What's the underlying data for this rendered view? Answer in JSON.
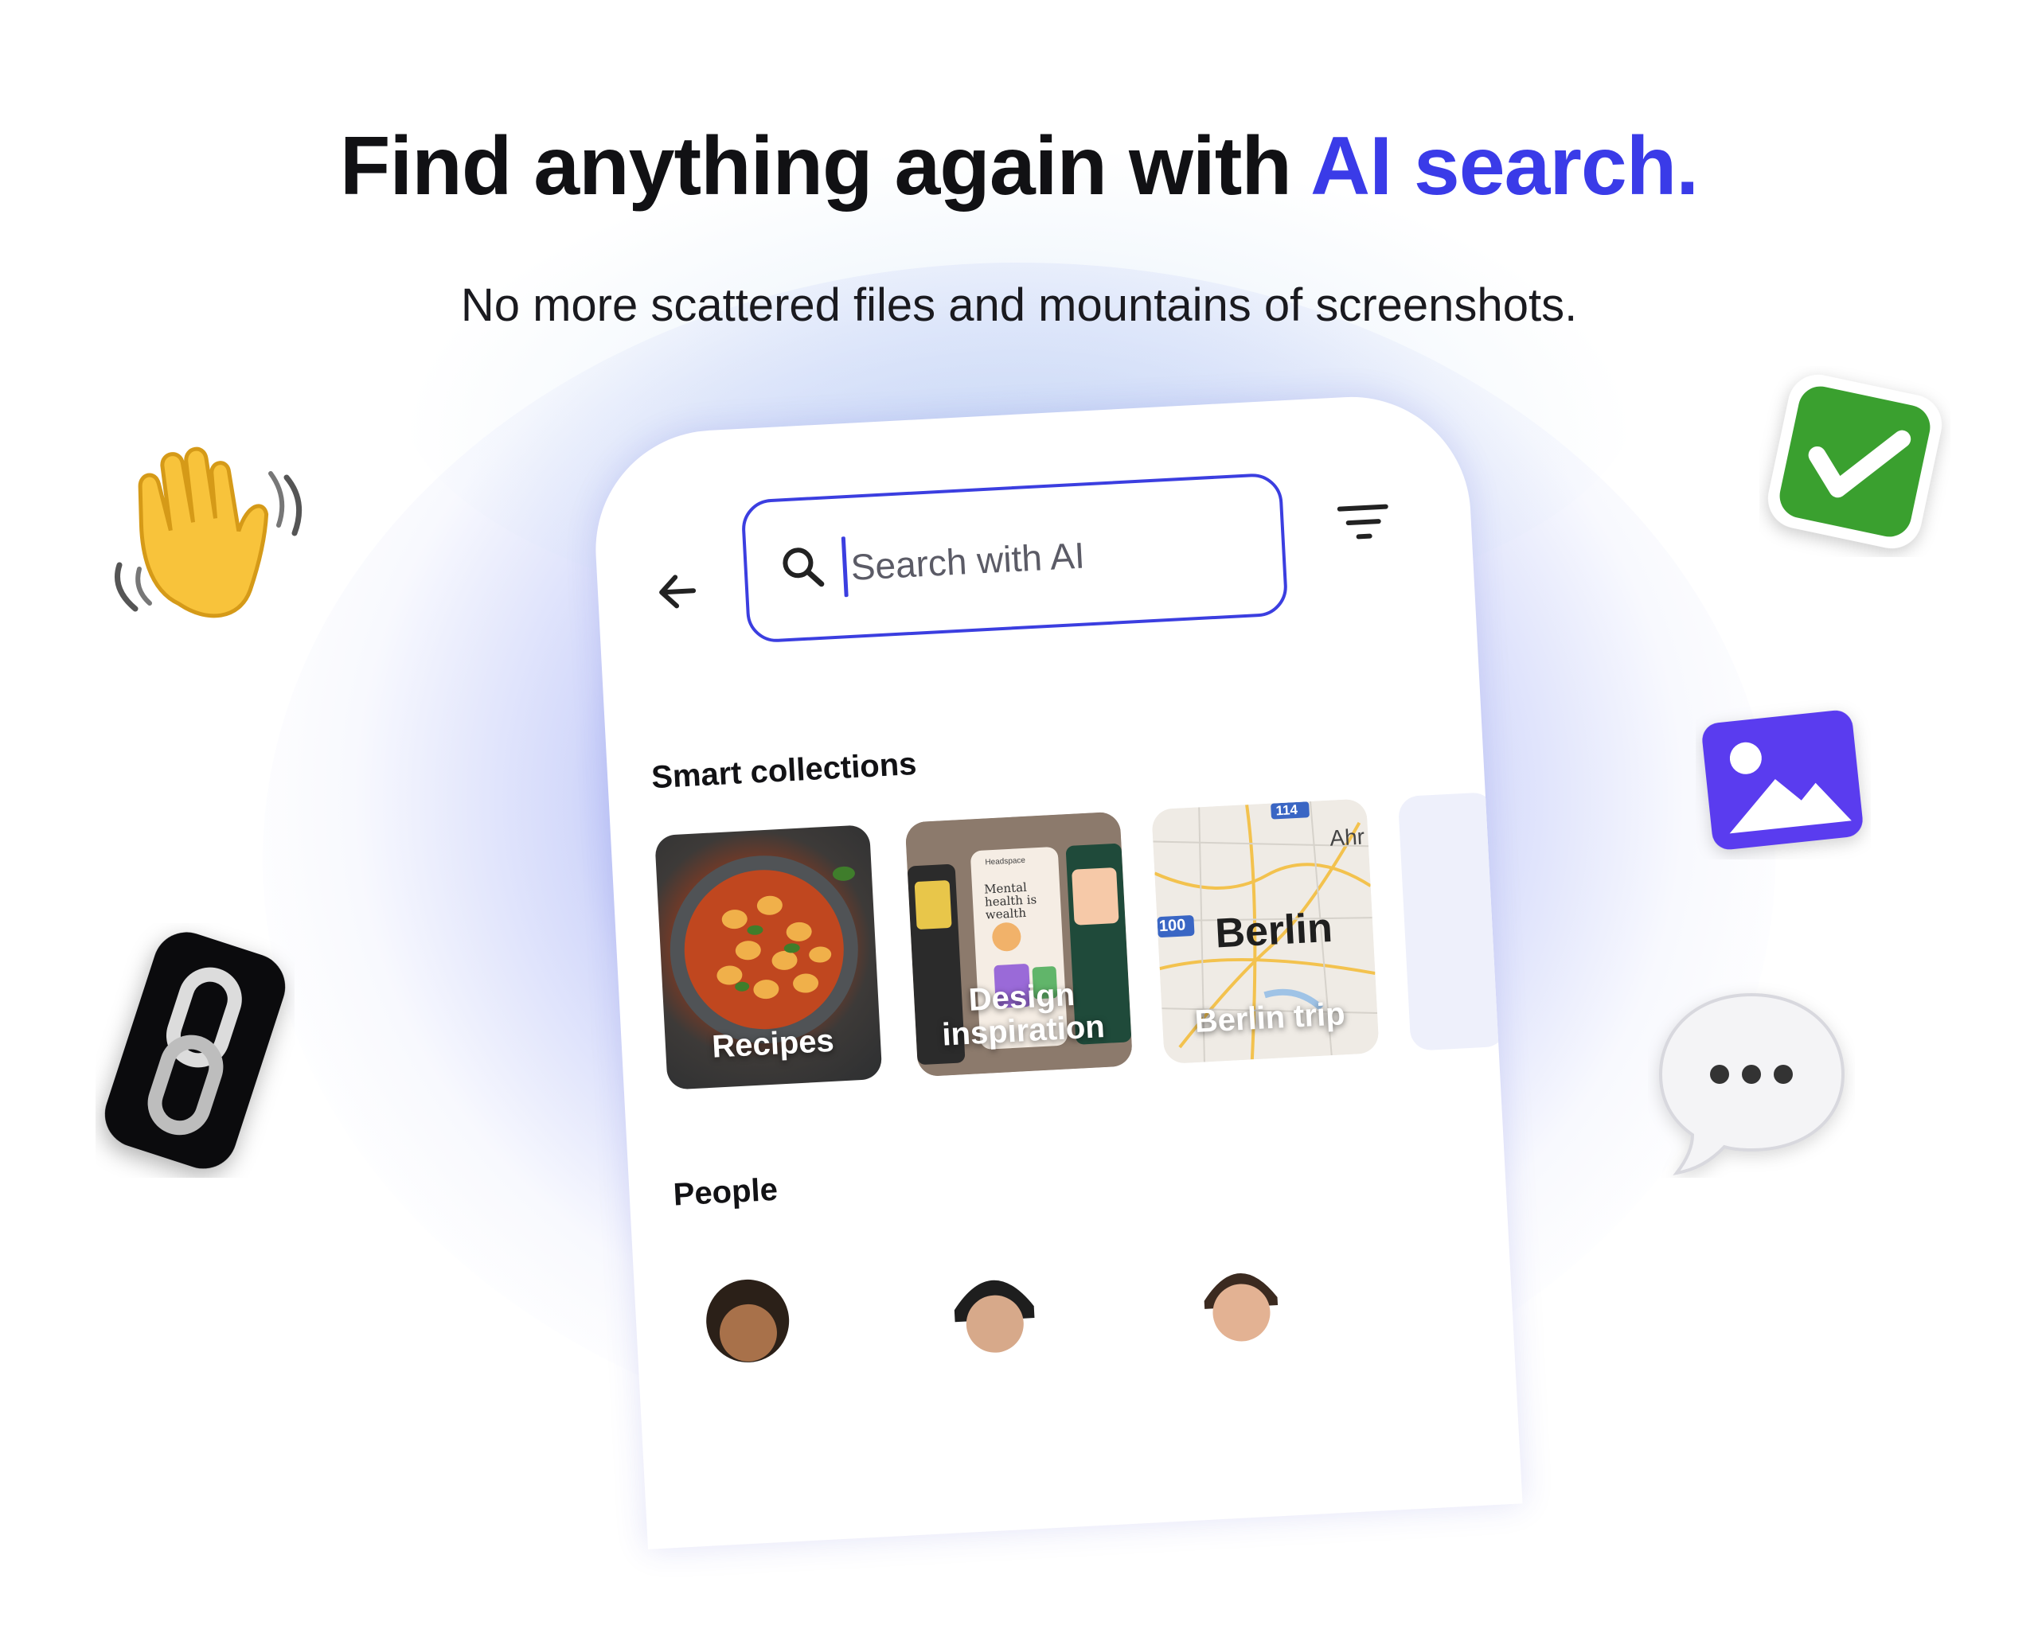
{
  "headline": {
    "main": "Find anything again with ",
    "accent": "AI search."
  },
  "subheadline": "No more scattered files and mountains of screenshots.",
  "app": {
    "search": {
      "placeholder": "Search with AI"
    },
    "sections": {
      "smart_collections": {
        "title": "Smart collections",
        "items": [
          {
            "label": "Recipes"
          },
          {
            "label": "Design inspiration"
          },
          {
            "label": "Berlin trip"
          }
        ]
      },
      "people": {
        "title": "People"
      }
    },
    "design_card_text": {
      "headline_mock": "Mental health is wealth",
      "brand_mock": "Headspace"
    },
    "berlin_map_text": {
      "city": "Berlin",
      "road1": "100",
      "road2": "114",
      "place": "Ahr"
    }
  },
  "colors": {
    "accent": "#3a3be8",
    "glow": "#5468ee"
  },
  "icons": [
    "back-arrow-icon",
    "search-icon",
    "filter-icon",
    "waving-hand-icon",
    "check-mark-icon",
    "image-icon",
    "link-icon",
    "speech-bubble-icon"
  ]
}
